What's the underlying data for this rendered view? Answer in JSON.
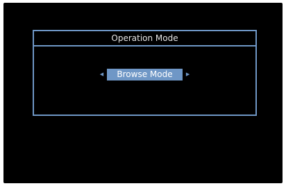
{
  "dialog": {
    "title": "Operation Mode",
    "selected_option": "Browse Mode",
    "left_arrow": "◀",
    "right_arrow": "▶"
  },
  "colors": {
    "background": "#000000",
    "accent": "#6f97c6",
    "title_text": "#e6e6e6",
    "selected_text": "#ffffff"
  }
}
